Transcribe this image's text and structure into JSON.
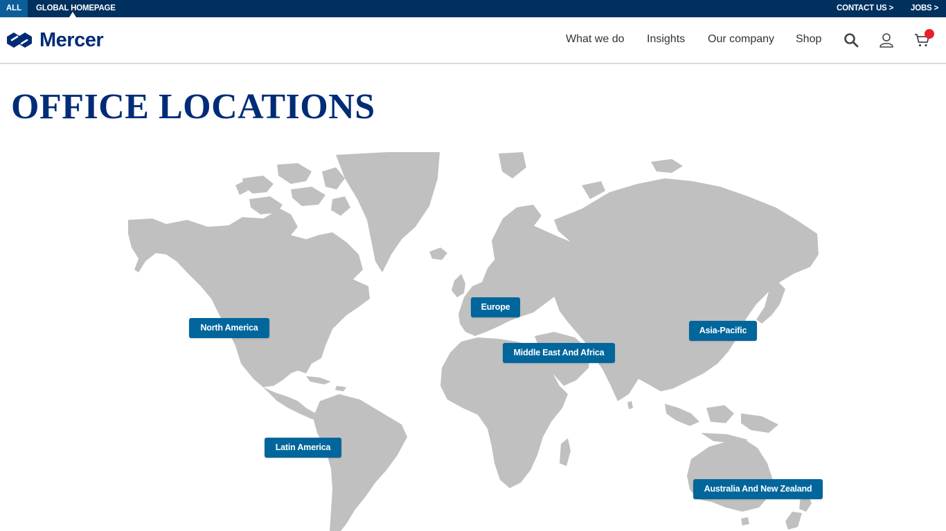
{
  "utility": {
    "all": "ALL",
    "homepage": "GLOBAL HOMEPAGE",
    "contact": "CONTACT US >",
    "jobs": "JOBS >"
  },
  "header": {
    "logo": "Mercer",
    "nav": [
      "What we do",
      "Insights",
      "Our company",
      "Shop"
    ],
    "icons": [
      "search-icon",
      "user-icon",
      "cart-icon"
    ]
  },
  "page": {
    "title": "OFFICE LOCATIONS"
  },
  "regions": [
    "North America",
    "Europe",
    "Middle East And Africa",
    "Asia-Pacific",
    "Latin America",
    "Australia And New Zealand"
  ],
  "colors": {
    "brand_navy": "#002c77",
    "utility_bar": "#00305e",
    "region_button": "#00669b",
    "map_land": "#c0c0c0",
    "cart_badge": "#e8202a"
  }
}
